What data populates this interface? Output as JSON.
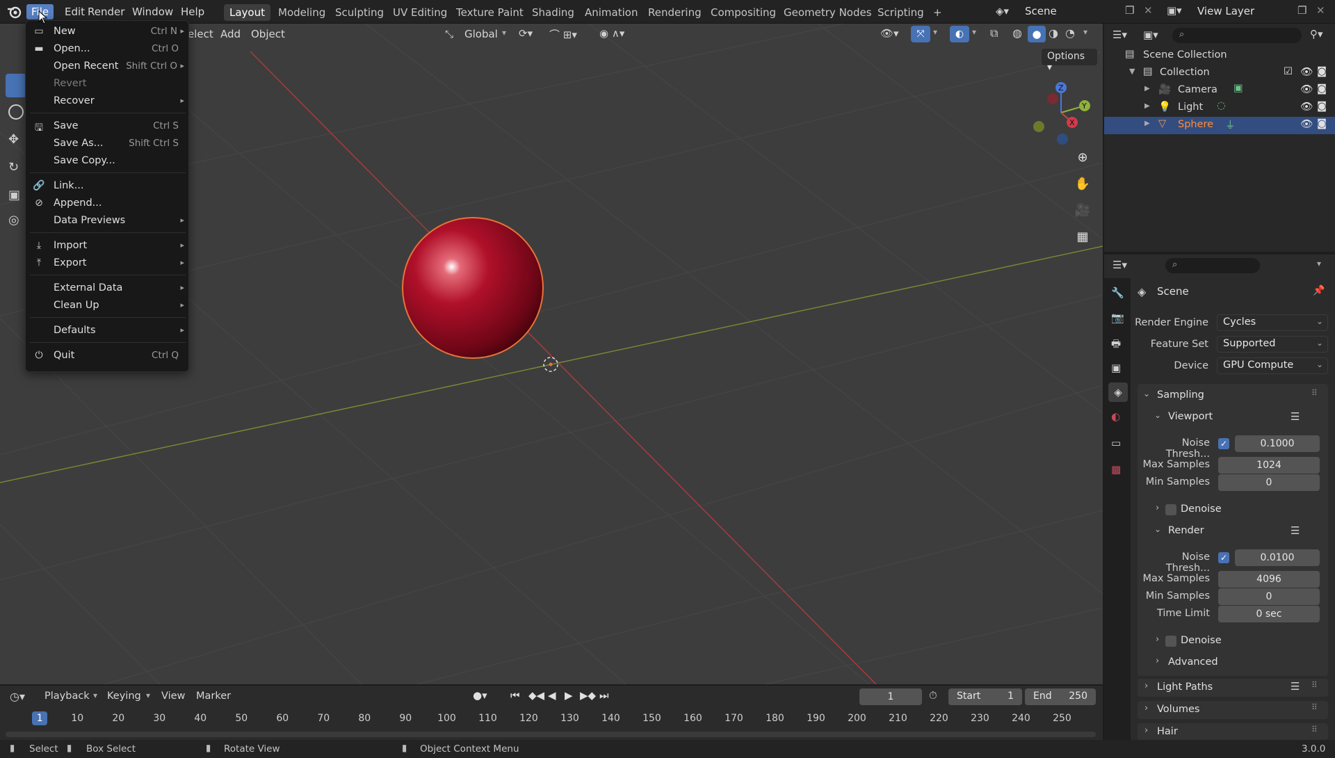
{
  "topbar": {
    "menus": [
      "File",
      "Edit",
      "Render",
      "Window",
      "Help"
    ],
    "workspaces": [
      "Layout",
      "Modeling",
      "Sculpting",
      "UV Editing",
      "Texture Paint",
      "Shading",
      "Animation",
      "Rendering",
      "Compositing",
      "Geometry Nodes",
      "Scripting"
    ],
    "add_tab": "+",
    "scene_label": "Scene",
    "view_layer_label": "View Layer"
  },
  "viewport": {
    "header_menus": [
      "elect",
      "Add",
      "Object"
    ],
    "orientation": "Global",
    "options_label": "Options",
    "gizmo": {
      "z": "Z",
      "y": "Y",
      "x": "X"
    }
  },
  "file_menu": {
    "items": [
      {
        "label": "New",
        "shortcut": "Ctrl N",
        "icon": "new-file-icon",
        "submenu": true
      },
      {
        "label": "Open...",
        "shortcut": "Ctrl O",
        "icon": "folder-icon"
      },
      {
        "label": "Open Recent",
        "shortcut": "Shift Ctrl O",
        "submenu": true
      },
      {
        "label": "Revert",
        "disabled": true
      },
      {
        "label": "Recover",
        "submenu": true
      },
      {
        "label": "Save",
        "shortcut": "Ctrl S",
        "icon": "save-icon"
      },
      {
        "label": "Save As...",
        "shortcut": "Shift Ctrl S"
      },
      {
        "label": "Save Copy..."
      },
      {
        "label": "Link...",
        "icon": "link-icon"
      },
      {
        "label": "Append...",
        "icon": "append-icon"
      },
      {
        "label": "Data Previews",
        "submenu": true
      },
      {
        "label": "Import",
        "icon": "import-icon",
        "submenu": true
      },
      {
        "label": "Export",
        "icon": "export-icon",
        "submenu": true
      },
      {
        "label": "External Data",
        "submenu": true
      },
      {
        "label": "Clean Up",
        "submenu": true
      },
      {
        "label": "Defaults",
        "submenu": true
      },
      {
        "label": "Quit",
        "shortcut": "Ctrl Q",
        "icon": "power-icon"
      }
    ]
  },
  "outliner": {
    "root": "Scene Collection",
    "collection": "Collection",
    "objects": [
      "Camera",
      "Light",
      "Sphere"
    ],
    "selected": "Sphere"
  },
  "properties": {
    "context": "Scene",
    "render_engine_label": "Render Engine",
    "render_engine": "Cycles",
    "feature_set_label": "Feature Set",
    "feature_set": "Supported",
    "device_label": "Device",
    "device": "GPU Compute",
    "sampling_label": "Sampling",
    "viewport_label": "Viewport",
    "viewport": {
      "noise_label": "Noise Thresh...",
      "noise": "0.1000",
      "max_label": "Max Samples",
      "max": "1024",
      "min_label": "Min Samples",
      "min": "0"
    },
    "denoise_label": "Denoise",
    "render_label": "Render",
    "render": {
      "noise_label": "Noise Thresh...",
      "noise": "0.0100",
      "max_label": "Max Samples",
      "max": "4096",
      "min_label": "Min Samples",
      "min": "0",
      "time_label": "Time Limit",
      "time": "0 sec"
    },
    "advanced_label": "Advanced",
    "light_paths_label": "Light Paths",
    "volumes_label": "Volumes",
    "hair_label": "Hair"
  },
  "timeline": {
    "menus": [
      "Playback",
      "Keying",
      "View",
      "Marker"
    ],
    "current_frame": "1",
    "start_label": "Start",
    "start": "1",
    "end_label": "End",
    "end": "250",
    "ticks": [
      "1",
      "10",
      "20",
      "30",
      "40",
      "50",
      "60",
      "70",
      "80",
      "90",
      "100",
      "110",
      "120",
      "130",
      "140",
      "150",
      "160",
      "170",
      "180",
      "190",
      "200",
      "210",
      "220",
      "230",
      "240",
      "250"
    ]
  },
  "statusbar": {
    "select": "Select",
    "box_select": "Box Select",
    "rotate_view": "Rotate View",
    "context_menu": "Object Context Menu",
    "version": "3.0.0"
  },
  "colors": {
    "accent": "#4772b3",
    "active_menu": "#5680c2",
    "sphere": "#b0102a",
    "selected_text": "#ff8c3a",
    "x_axis": "#c4474b",
    "y_axis": "#8fb23c"
  }
}
